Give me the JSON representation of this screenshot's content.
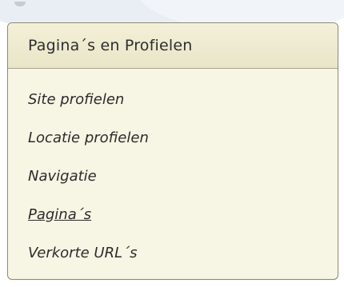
{
  "panel": {
    "title": "Pagina´s en Profielen",
    "items": [
      {
        "label": "Site profielen",
        "active": false
      },
      {
        "label": "Locatie profielen",
        "active": false
      },
      {
        "label": "Navigatie",
        "active": false
      },
      {
        "label": "Pagina´s",
        "active": true
      },
      {
        "label": "Verkorte URL´s",
        "active": false
      }
    ]
  },
  "colors": {
    "panel_background": "#f7f5e3",
    "header_background": "#ece9cf",
    "border": "#8e8a6f",
    "text": "#2c2c2c"
  }
}
